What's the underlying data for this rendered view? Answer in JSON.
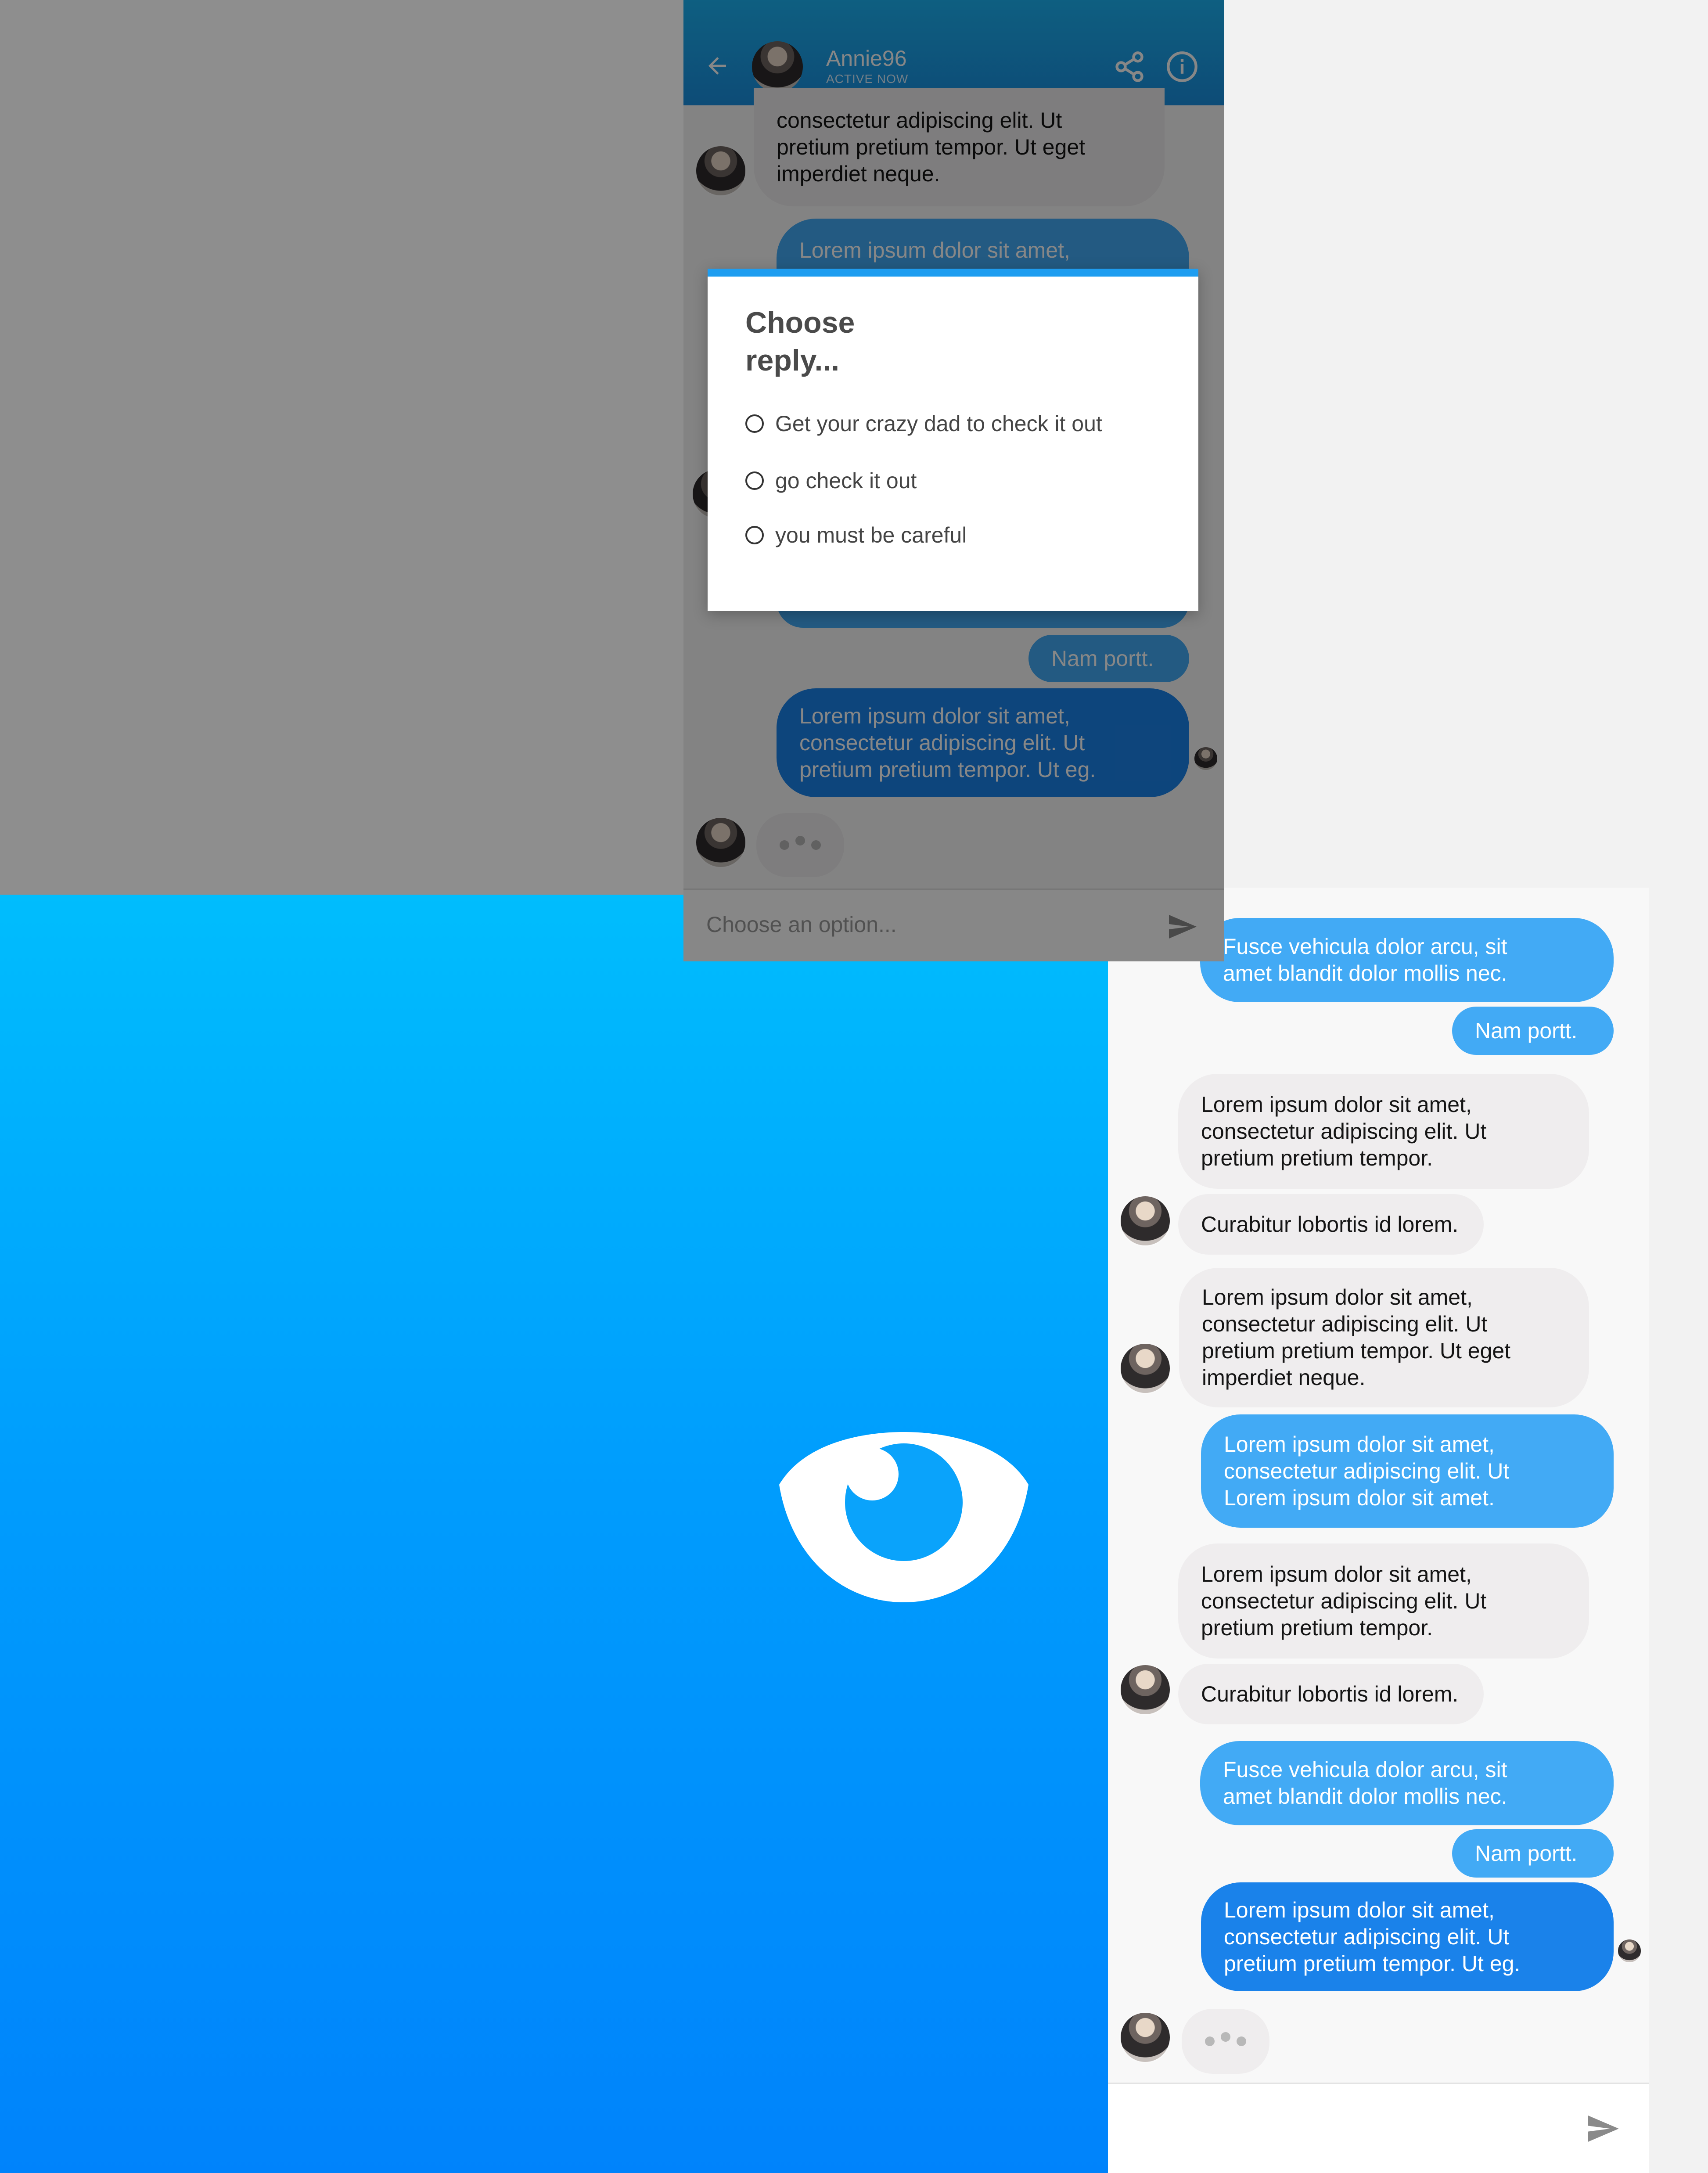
{
  "top_screen": {
    "header": {
      "name": "Annie96",
      "status": "ACTIVE NOW",
      "back_icon": "arrow-left-icon",
      "share_icon": "share-icon",
      "info_icon": "info-icon"
    },
    "messages": [
      {
        "side": "in",
        "text": "consectetur adipiscing elit. Ut\npretium pretium tempor. Ut eget\nimperdiet neque."
      },
      {
        "side": "out",
        "text": "Lorem ipsum dolor sit amet,"
      },
      {
        "side": "out",
        "text": "Nam portt."
      },
      {
        "side": "out",
        "text": "Lorem ipsum dolor sit amet,\nconsectetur adipiscing elit. Ut\npretium pretium tempor. Ut eg."
      }
    ],
    "input_placeholder": "Choose an option..."
  },
  "dialog": {
    "title": "Choose reply...",
    "options": [
      "Get your crazy dad to check it out",
      "go check it out",
      "you must be careful"
    ]
  },
  "right_chat": {
    "messages": [
      {
        "side": "out",
        "text": "Fusce vehicula dolor arcu, sit\namet blandit dolor mollis nec."
      },
      {
        "side": "out",
        "text": "Nam portt."
      },
      {
        "side": "in",
        "text": "Lorem ipsum dolor sit amet,\nconsectetur adipiscing elit. Ut\npretium pretium tempor."
      },
      {
        "side": "in",
        "text": "Curabitur lobortis id lorem."
      },
      {
        "side": "in",
        "text": "Lorem ipsum dolor sit amet,\nconsectetur adipiscing elit. Ut\npretium pretium tempor. Ut eget\nimperdiet neque."
      },
      {
        "side": "out",
        "text": "Lorem ipsum dolor sit amet,\nconsectetur adipiscing elit. Ut\nLorem ipsum dolor sit amet."
      },
      {
        "side": "in",
        "text": "Lorem ipsum dolor sit amet,\nconsectetur adipiscing elit. Ut\npretium pretium tempor."
      },
      {
        "side": "in",
        "text": "Curabitur lobortis id lorem."
      },
      {
        "side": "out",
        "text": "Fusce vehicula dolor arcu, sit\namet blandit dolor mollis nec."
      },
      {
        "side": "out",
        "text": "Nam portt."
      },
      {
        "side": "out",
        "text": "Lorem ipsum dolor sit amet,\nconsectetur adipiscing elit. Ut\npretium pretium tempor. Ut eg."
      }
    ],
    "send_icon": "send-icon"
  },
  "splash": {
    "logo_icon": "eye-logo-icon",
    "colors": {
      "top": "#00bdfd",
      "bottom": "#0083fb"
    }
  },
  "colors": {
    "accent": "#1e9df0",
    "bubble_out": "#42aaf5",
    "bubble_out_dark": "#1a82ea",
    "bubble_in": "#efedee"
  }
}
